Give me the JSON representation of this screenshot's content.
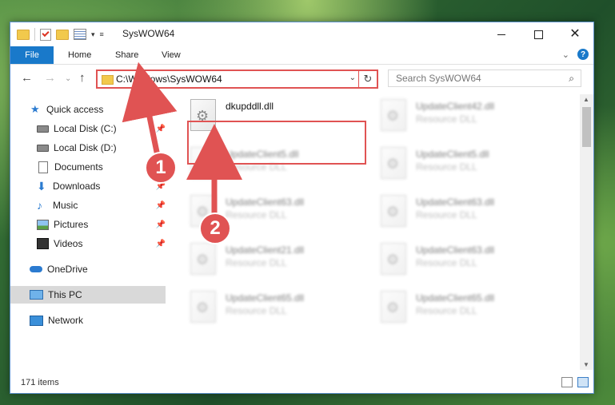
{
  "window": {
    "title": "SysWOW64"
  },
  "ribbon": {
    "tabs": [
      {
        "label": "File"
      },
      {
        "label": "Home"
      },
      {
        "label": "Share"
      },
      {
        "label": "View"
      }
    ]
  },
  "navbar": {
    "address": "C:\\Windows\\SysWOW64",
    "search_placeholder": "Search SysWOW64"
  },
  "sidebar": {
    "items": [
      {
        "label": "Quick access",
        "icon": "star-icon"
      },
      {
        "label": "Local Disk (C:)",
        "icon": "drive-icon",
        "pinned": true
      },
      {
        "label": "Local Disk (D:)",
        "icon": "drive-icon",
        "pinned": false
      },
      {
        "label": "Documents",
        "icon": "documents-icon",
        "pinned": true
      },
      {
        "label": "Downloads",
        "icon": "downloads-icon",
        "pinned": true
      },
      {
        "label": "Music",
        "icon": "music-icon",
        "pinned": true
      },
      {
        "label": "Pictures",
        "icon": "pictures-icon",
        "pinned": true
      },
      {
        "label": "Videos",
        "icon": "videos-icon",
        "pinned": true
      },
      {
        "label": "OneDrive",
        "icon": "onedrive-icon"
      },
      {
        "label": "This PC",
        "icon": "this-pc-icon",
        "selected": true
      },
      {
        "label": "Network",
        "icon": "network-icon"
      }
    ]
  },
  "files": [
    {
      "name": "dkupddll.dll",
      "type": "",
      "highlighted": true
    },
    {
      "name": "UpdateClient42.dll",
      "type": "Resource DLL"
    },
    {
      "name": "UpdateClient5.dll",
      "type": "Resource DLL"
    },
    {
      "name": "UpdateClient5.dll",
      "type": "Resource DLL"
    },
    {
      "name": "UpdateClient63.dll",
      "type": "Resource DLL"
    },
    {
      "name": "UpdateClient63.dll",
      "type": "Resource DLL"
    },
    {
      "name": "UpdateClient21.dll",
      "type": "Resource DLL"
    },
    {
      "name": "UpdateClient63.dll",
      "type": "Resource DLL"
    },
    {
      "name": "UpdateClient65.dll",
      "type": "Resource DLL"
    },
    {
      "name": "UpdateClient65.dll",
      "type": "Resource DLL"
    }
  ],
  "status": {
    "count": "171 items"
  },
  "annotations": {
    "step1": "1",
    "step2": "2",
    "color": "#e05353"
  }
}
